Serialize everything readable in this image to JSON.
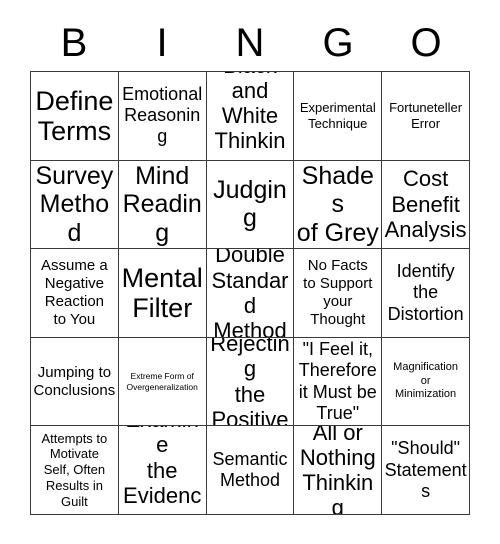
{
  "card": {
    "title": "BINGO",
    "header_letters": [
      "B",
      "I",
      "N",
      "G",
      "O"
    ],
    "grid_size": "5x5",
    "colors": {
      "background": "#ffffff",
      "text": "#000000",
      "border": "#3a3a3a"
    }
  },
  "cells": [
    {
      "text": "Define\nTerms",
      "size": "xxl"
    },
    {
      "text": "Emotional\nReasoning",
      "size": "md"
    },
    {
      "text": "Black and\nWhite\nThinking",
      "size": "lg"
    },
    {
      "text": "Experimental\nTechnique",
      "size": "xs"
    },
    {
      "text": "Fortuneteller\nError",
      "size": "xs"
    },
    {
      "text": "Survey\nMethod",
      "size": "xl"
    },
    {
      "text": "Mind\nReading",
      "size": "xl"
    },
    {
      "text": "Judging",
      "size": "xl"
    },
    {
      "text": "Shades\nof Grey",
      "size": "xl"
    },
    {
      "text": "Cost\nBenefit\nAnalysis",
      "size": "lg"
    },
    {
      "text": "Assume a\nNegative\nReaction\nto You",
      "size": "sm"
    },
    {
      "text": "Mental\nFilter",
      "size": "xxl"
    },
    {
      "text": "Double\nStandard\nMethod",
      "size": "lg"
    },
    {
      "text": "No Facts\nto Support\nyour\nThought",
      "size": "sm"
    },
    {
      "text": "Identify\nthe\nDistortion",
      "size": "md"
    },
    {
      "text": "Jumping to\nConclusions",
      "size": "sm"
    },
    {
      "text": "Extreme Form of\nOvergeneralization",
      "size": "tiny"
    },
    {
      "text": "Rejecting\nthe\nPositive",
      "size": "lg"
    },
    {
      "text": "\"I Feel it,\nTherefore\nit Must be\nTrue\"",
      "size": "md"
    },
    {
      "text": "Magnification\nor\nMinimization",
      "size": "xxs"
    },
    {
      "text": "Attempts to\nMotivate\nSelf, Often\nResults in\nGuilt",
      "size": "xs"
    },
    {
      "text": "Examine\nthe\nEvidence",
      "size": "lg"
    },
    {
      "text": "Semantic\nMethod",
      "size": "md"
    },
    {
      "text": "All or\nNothing\nThinking",
      "size": "lg"
    },
    {
      "text": "\"Should\"\nStatements",
      "size": "md"
    }
  ]
}
